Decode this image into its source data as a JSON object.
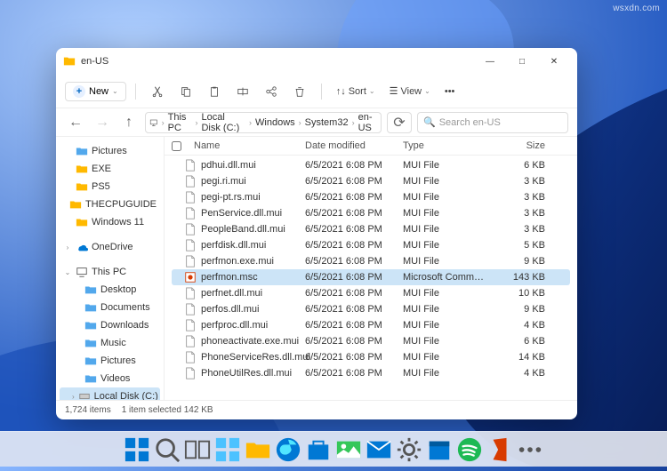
{
  "watermark": "wsxdn.com",
  "window": {
    "title": "en-US",
    "controls": {
      "min": "—",
      "max": "□",
      "close": "✕"
    }
  },
  "toolbar": {
    "new_label": "New",
    "sort_label": "Sort",
    "view_label": "View",
    "more": "•••"
  },
  "breadcrumb": {
    "items": [
      "This PC",
      "Local Disk (C:)",
      "Windows",
      "System32",
      "en-US"
    ]
  },
  "search": {
    "placeholder": "Search en-US"
  },
  "columns": {
    "name": "Name",
    "date": "Date modified",
    "type": "Type",
    "size": "Size"
  },
  "sidebar": {
    "quick": [
      {
        "label": "Pictures",
        "icon": "pictures",
        "chev": ""
      },
      {
        "label": "EXE",
        "icon": "folder",
        "chev": ""
      },
      {
        "label": "PS5",
        "icon": "folder",
        "chev": ""
      },
      {
        "label": "THECPUGUIDE",
        "icon": "folder",
        "chev": ""
      },
      {
        "label": "Windows 11",
        "icon": "folder",
        "chev": ""
      }
    ],
    "onedrive": {
      "label": "OneDrive",
      "chev": "›"
    },
    "thispc": {
      "label": "This PC",
      "chev": "⌄"
    },
    "pc_items": [
      {
        "label": "Desktop",
        "icon": "desktop"
      },
      {
        "label": "Documents",
        "icon": "documents"
      },
      {
        "label": "Downloads",
        "icon": "downloads"
      },
      {
        "label": "Music",
        "icon": "music"
      },
      {
        "label": "Pictures",
        "icon": "pictures"
      },
      {
        "label": "Videos",
        "icon": "videos"
      },
      {
        "label": "Local Disk (C:)",
        "icon": "disk",
        "chev": "›",
        "selected": true
      }
    ]
  },
  "files": [
    {
      "name": "pdhui.dll.mui",
      "date": "6/5/2021 6:08 PM",
      "type": "MUI File",
      "size": "6 KB",
      "icon": "file"
    },
    {
      "name": "pegi.ri.mui",
      "date": "6/5/2021 6:08 PM",
      "type": "MUI File",
      "size": "3 KB",
      "icon": "file"
    },
    {
      "name": "pegi-pt.rs.mui",
      "date": "6/5/2021 6:08 PM",
      "type": "MUI File",
      "size": "3 KB",
      "icon": "file"
    },
    {
      "name": "PenService.dll.mui",
      "date": "6/5/2021 6:08 PM",
      "type": "MUI File",
      "size": "3 KB",
      "icon": "file"
    },
    {
      "name": "PeopleBand.dll.mui",
      "date": "6/5/2021 6:08 PM",
      "type": "MUI File",
      "size": "3 KB",
      "icon": "file"
    },
    {
      "name": "perfdisk.dll.mui",
      "date": "6/5/2021 6:08 PM",
      "type": "MUI File",
      "size": "5 KB",
      "icon": "file"
    },
    {
      "name": "perfmon.exe.mui",
      "date": "6/5/2021 6:08 PM",
      "type": "MUI File",
      "size": "9 KB",
      "icon": "file"
    },
    {
      "name": "perfmon.msc",
      "date": "6/5/2021 6:08 PM",
      "type": "Microsoft Comm…",
      "size": "143 KB",
      "icon": "msc",
      "selected": true
    },
    {
      "name": "perfnet.dll.mui",
      "date": "6/5/2021 6:08 PM",
      "type": "MUI File",
      "size": "10 KB",
      "icon": "file"
    },
    {
      "name": "perfos.dll.mui",
      "date": "6/5/2021 6:08 PM",
      "type": "MUI File",
      "size": "9 KB",
      "icon": "file"
    },
    {
      "name": "perfproc.dll.mui",
      "date": "6/5/2021 6:08 PM",
      "type": "MUI File",
      "size": "4 KB",
      "icon": "file"
    },
    {
      "name": "phoneactivate.exe.mui",
      "date": "6/5/2021 6:08 PM",
      "type": "MUI File",
      "size": "6 KB",
      "icon": "file"
    },
    {
      "name": "PhoneServiceRes.dll.mui",
      "date": "6/5/2021 6:08 PM",
      "type": "MUI File",
      "size": "14 KB",
      "icon": "file"
    },
    {
      "name": "PhoneUtilRes.dll.mui",
      "date": "6/5/2021 6:08 PM",
      "type": "MUI File",
      "size": "4 KB",
      "icon": "file"
    }
  ],
  "statusbar": {
    "count": "1,724 items",
    "selection": "1 item selected   142 KB"
  },
  "taskbar_apps": [
    "start",
    "search",
    "taskview",
    "widgets",
    "explorer",
    "edge",
    "store",
    "photos",
    "mail",
    "settings",
    "calendar",
    "spotify",
    "office",
    "more"
  ]
}
